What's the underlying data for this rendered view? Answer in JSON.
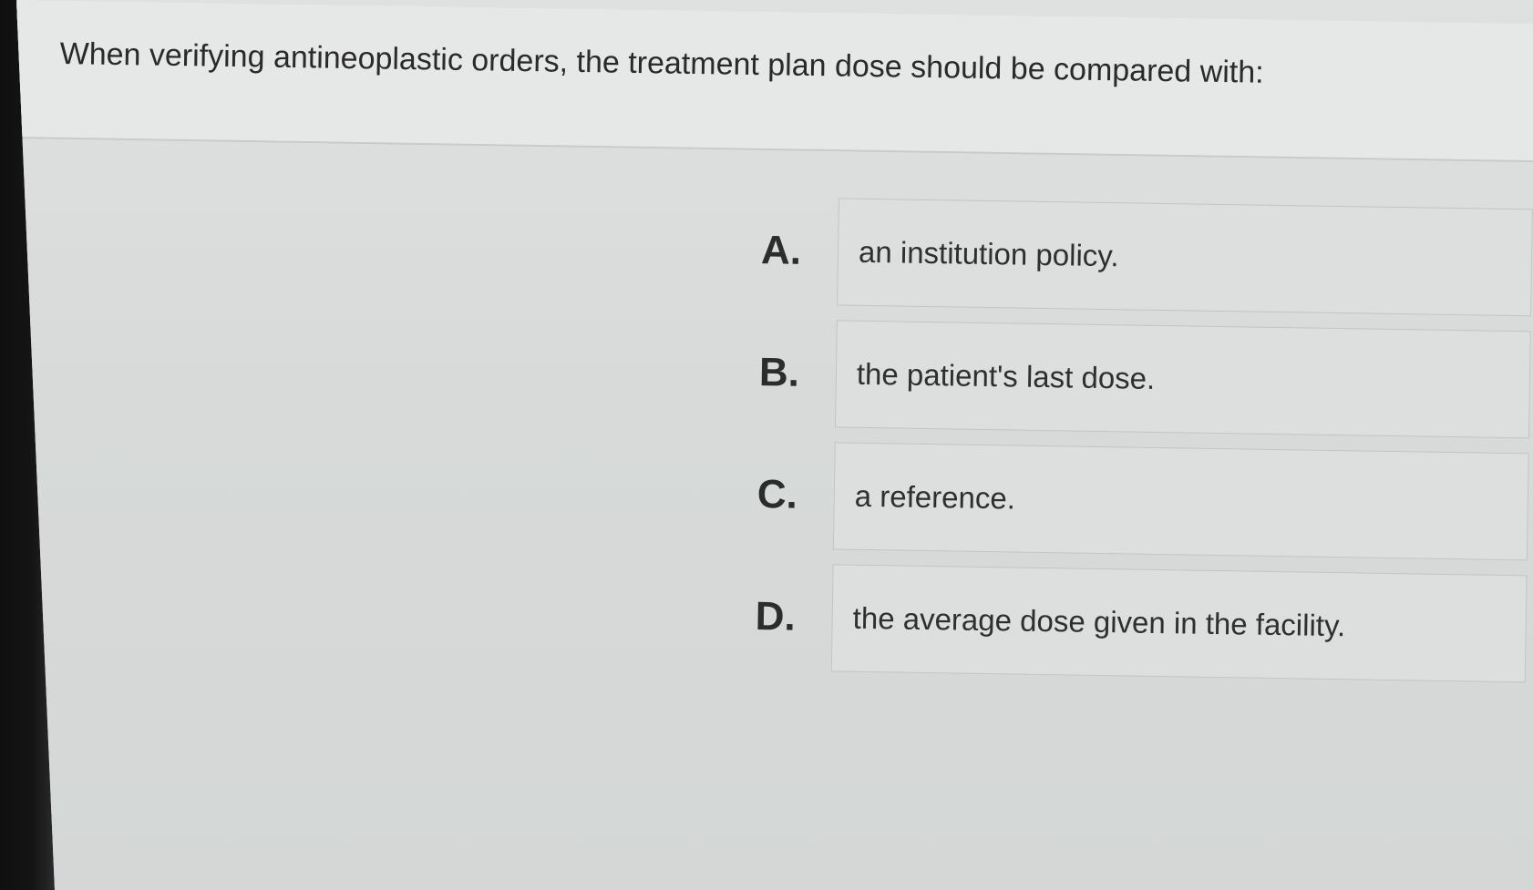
{
  "question": {
    "text": "When verifying antineoplastic orders, the treatment plan dose should be compared with:"
  },
  "options": [
    {
      "letter": "A.",
      "text": "an institution policy."
    },
    {
      "letter": "B.",
      "text": "the patient's last dose."
    },
    {
      "letter": "C.",
      "text": "a reference."
    },
    {
      "letter": "D.",
      "text": "the average dose given in the facility."
    }
  ]
}
